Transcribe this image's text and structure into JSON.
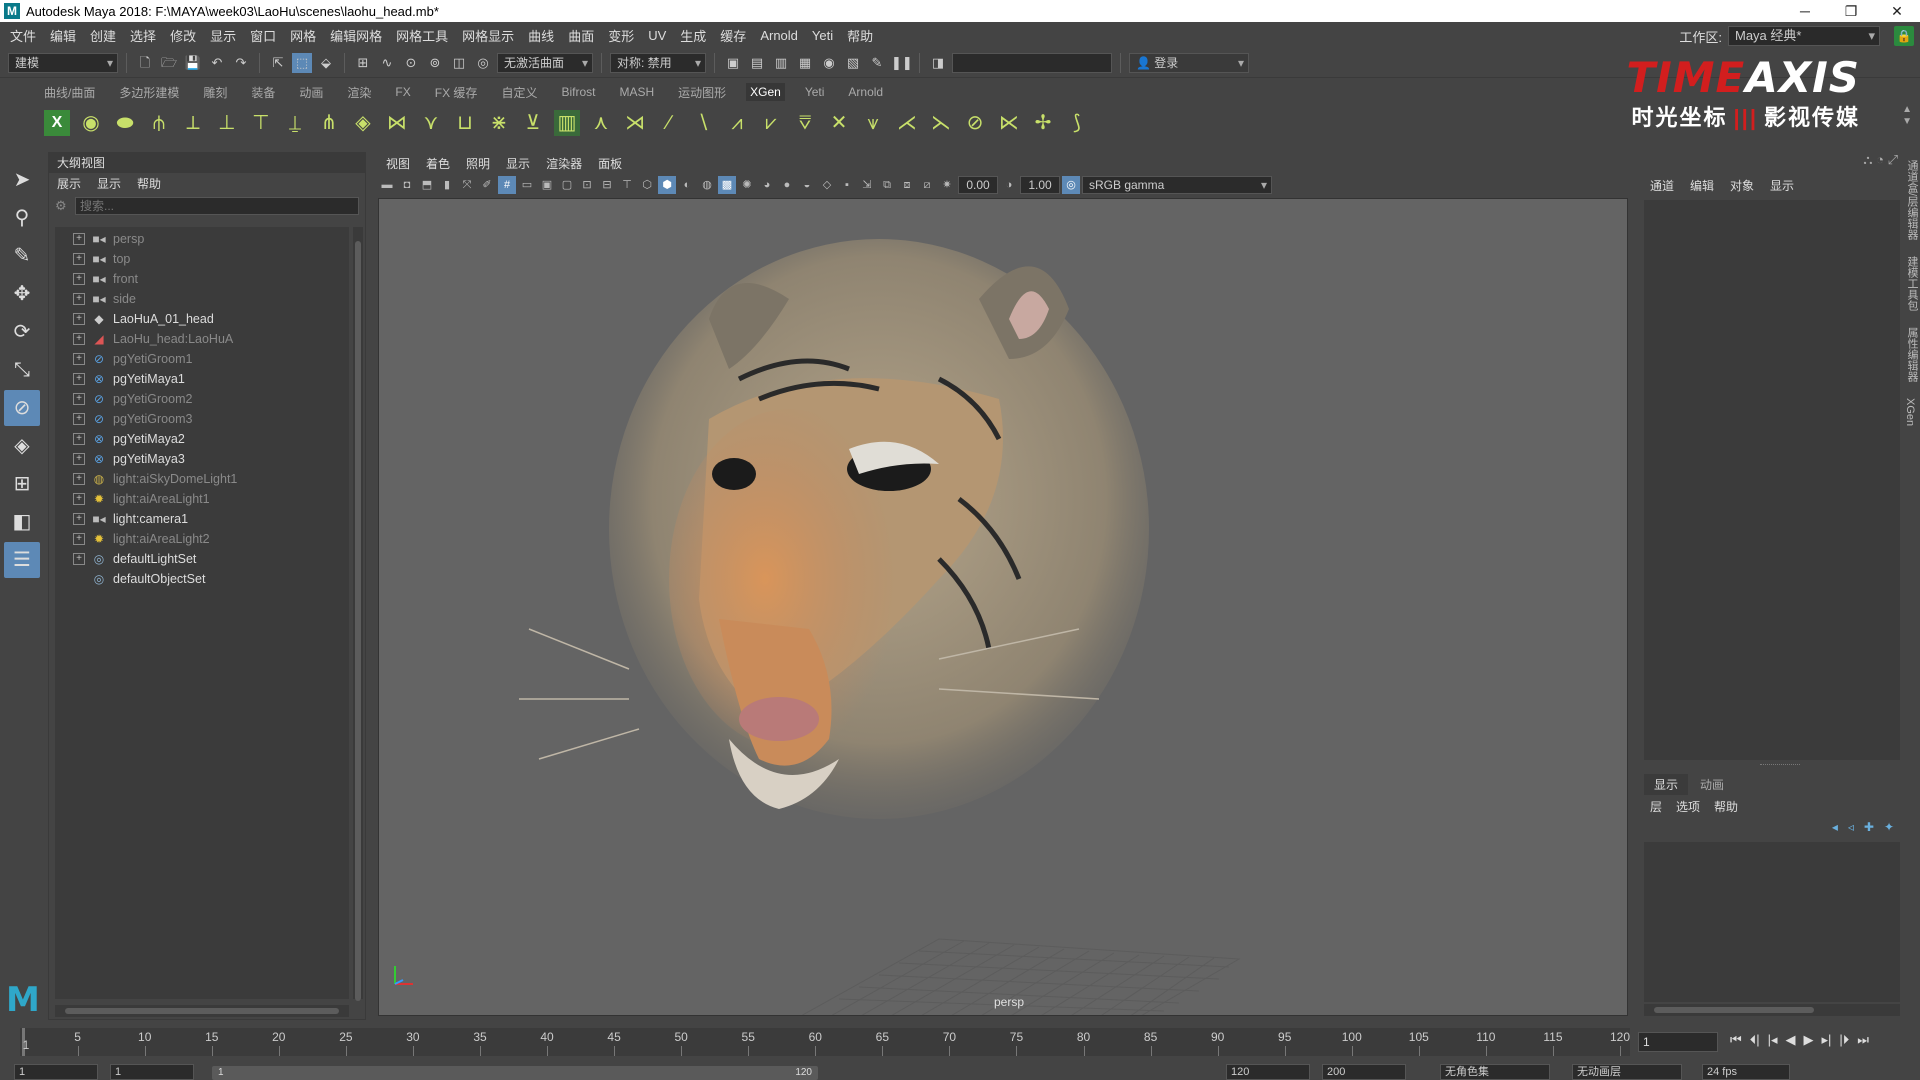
{
  "window": {
    "title": "Autodesk Maya 2018: F:\\MAYA\\week03\\LaoHu\\scenes\\laohu_head.mb*",
    "icon": "M"
  },
  "menubar": {
    "items": [
      "文件",
      "编辑",
      "创建",
      "选择",
      "修改",
      "显示",
      "窗口",
      "网格",
      "编辑网格",
      "网格工具",
      "网格显示",
      "曲线",
      "曲面",
      "变形",
      "UV",
      "生成",
      "缓存",
      "Arnold",
      "Yeti",
      "帮助"
    ],
    "workspace_label": "工作区:",
    "workspace_value": "Maya 经典*"
  },
  "statusline": {
    "mode": "建模",
    "live_surface": "无激活曲面",
    "symmetry": "对称: 禁用",
    "login": "登录"
  },
  "shelf": {
    "tabs": [
      "曲线/曲面",
      "多边形建模",
      "雕刻",
      "装备",
      "动画",
      "渲染",
      "FX",
      "FX 缓存",
      "自定义",
      "Bifrost",
      "MASH",
      "运动图形",
      "XGen",
      "Yeti",
      "Arnold"
    ],
    "active_tab": "XGen"
  },
  "logo": {
    "brand_red": "TIME",
    "brand_white": "AXIS",
    "sub_left": "时光坐标",
    "sub_sep": "|||",
    "sub_right": "影视传媒",
    "colors": {
      "red": "#d21e1e",
      "white": "#ffffff"
    }
  },
  "outliner": {
    "title": "大纲视图",
    "menu": [
      "展示",
      "显示",
      "帮助"
    ],
    "search_placeholder": "搜索...",
    "items": [
      {
        "label": "persp",
        "icon": "camera-icon",
        "dim": true
      },
      {
        "label": "top",
        "icon": "camera-icon",
        "dim": true
      },
      {
        "label": "front",
        "icon": "camera-icon",
        "dim": true
      },
      {
        "label": "side",
        "icon": "camera-icon",
        "dim": true
      },
      {
        "label": "LaoHuA_01_head",
        "icon": "mesh-icon",
        "dim": false
      },
      {
        "label": "LaoHu_head:LaoHuA",
        "icon": "nurbs-icon",
        "dim": true
      },
      {
        "label": "pgYetiGroom1",
        "icon": "yeti-groom-icon",
        "dim": true
      },
      {
        "label": "pgYetiMaya1",
        "icon": "yeti-node-icon",
        "dim": false
      },
      {
        "label": "pgYetiGroom2",
        "icon": "yeti-groom-icon",
        "dim": true
      },
      {
        "label": "pgYetiGroom3",
        "icon": "yeti-groom-icon",
        "dim": true
      },
      {
        "label": "pgYetiMaya2",
        "icon": "yeti-node-icon",
        "dim": false
      },
      {
        "label": "pgYetiMaya3",
        "icon": "yeti-node-icon",
        "dim": false
      },
      {
        "label": "light:aiSkyDomeLight1",
        "icon": "skydome-light-icon",
        "dim": true
      },
      {
        "label": "light:aiAreaLight1",
        "icon": "area-light-icon",
        "dim": true
      },
      {
        "label": "light:camera1",
        "icon": "camera-icon",
        "dim": false
      },
      {
        "label": "light:aiAreaLight2",
        "icon": "area-light-icon",
        "dim": true
      },
      {
        "label": "defaultLightSet",
        "icon": "set-icon",
        "dim": false
      },
      {
        "label": "defaultObjectSet",
        "icon": "set-icon",
        "dim": false,
        "no_expand": true
      }
    ]
  },
  "viewport": {
    "menu": [
      "视图",
      "着色",
      "照明",
      "显示",
      "渲染器",
      "面板"
    ],
    "exposure": "0.00",
    "gamma": "1.00",
    "colorspace": "sRGB gamma",
    "camera_label": "persp"
  },
  "channelbox": {
    "menu": [
      "通道",
      "编辑",
      "对象",
      "显示"
    ],
    "layer_tabs": [
      "显示",
      "动画"
    ],
    "layer_menu": [
      "层",
      "选项",
      "帮助"
    ],
    "side_tabs": [
      "通道盒/层编辑器",
      "建模工具包",
      "属性编辑器",
      "XGen"
    ]
  },
  "timeslider": {
    "ticks": [
      5,
      10,
      15,
      20,
      25,
      30,
      35,
      40,
      45,
      50,
      55,
      60,
      65,
      70,
      75,
      80,
      85,
      90,
      95,
      100,
      105,
      110,
      115,
      120
    ],
    "start_label": "1",
    "current_frame": "1",
    "range_start": 1,
    "range_end": 120
  },
  "rangeslider": {
    "start": "1",
    "start2": "1",
    "bar_left": "1",
    "bar_right": "120",
    "end": "120",
    "end2": "200",
    "anim_layer": "无角色集",
    "anim_layer2": "无动画层",
    "fps": "24 fps"
  }
}
